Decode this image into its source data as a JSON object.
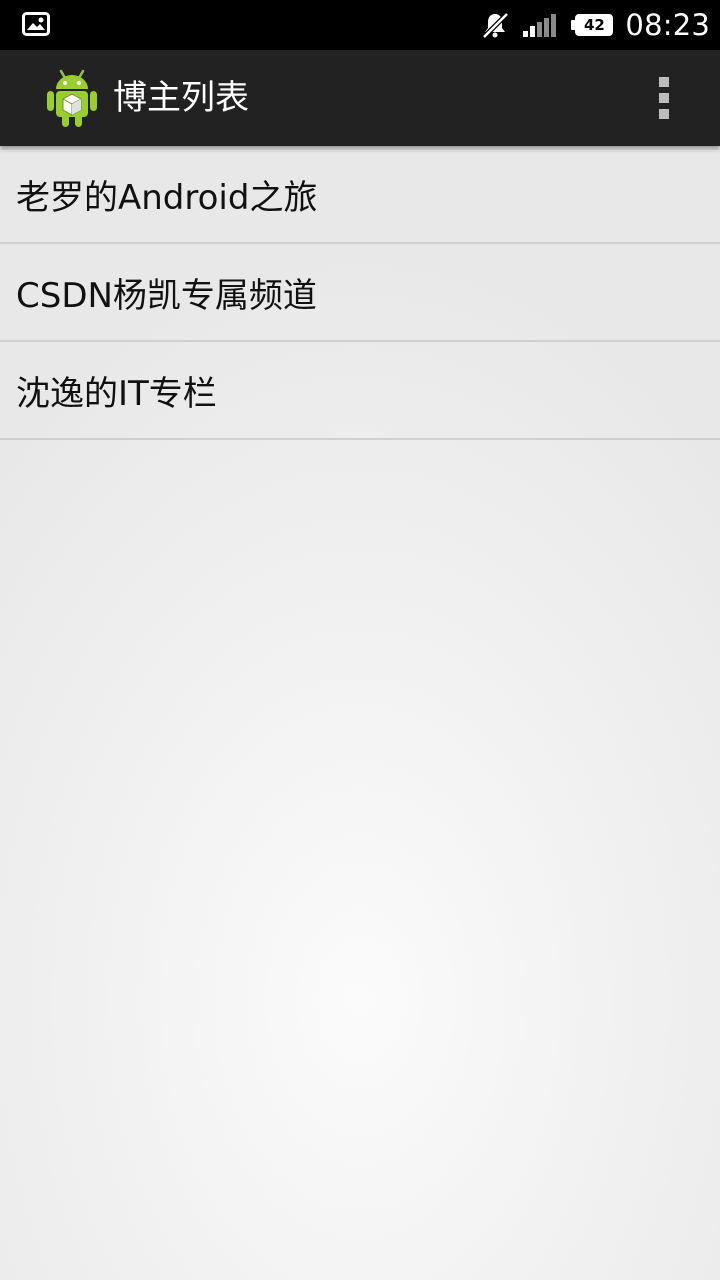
{
  "status_bar": {
    "time": "08:23",
    "battery_level": "42",
    "icons": [
      "image-notification-icon",
      "silent-mode-icon",
      "signal-strength-icon",
      "battery-icon"
    ]
  },
  "action_bar": {
    "title": "博主列表",
    "app_icon": "android-robot-icon",
    "menu_icon": "overflow-menu-icon"
  },
  "list": {
    "items": [
      {
        "label": "老罗的Android之旅"
      },
      {
        "label": "CSDN杨凯专属频道"
      },
      {
        "label": "沈逸的IT专栏"
      }
    ]
  },
  "colors": {
    "status_bar_bg": "#000000",
    "action_bar_bg": "#222222",
    "list_bg": "#e8e8e8",
    "divider": "#cfcfcf",
    "text": "#111111"
  }
}
